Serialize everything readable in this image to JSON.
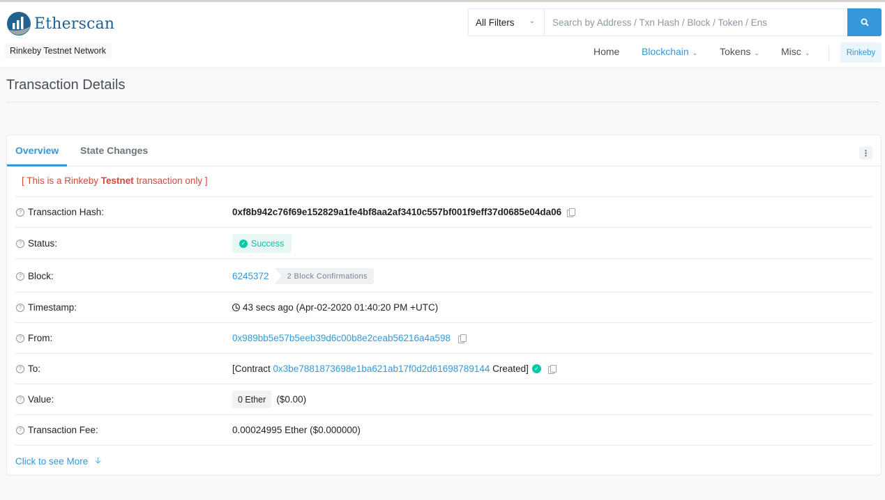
{
  "header": {
    "brand": "Etherscan",
    "network": "Rinkeby Testnet Network",
    "filter": {
      "selected": "All Filters"
    },
    "search": {
      "placeholder": "Search by Address / Txn Hash / Block / Token / Ens"
    },
    "nav": [
      {
        "label": "Home",
        "active": false
      },
      {
        "label": "Blockchain",
        "active": true,
        "dropdown": true
      },
      {
        "label": "Tokens",
        "active": false,
        "dropdown": true
      },
      {
        "label": "Misc",
        "active": false,
        "dropdown": true
      }
    ],
    "network_button": "Rinkeby"
  },
  "page": {
    "title": "Transaction Details"
  },
  "tabs": [
    {
      "label": "Overview",
      "active": true
    },
    {
      "label": "State Changes",
      "active": false
    }
  ],
  "notice": {
    "prefix": "[ This is a Rinkeby ",
    "bold": "Testnet",
    "suffix": " transaction only ]"
  },
  "details": {
    "hash": {
      "label": "Transaction Hash:",
      "value": "0xf8b942c76f69e152829a1fe4bf8aa2af3410c557bf001f9eff37d0685e04da06"
    },
    "status": {
      "label": "Status:",
      "value": "Success"
    },
    "block": {
      "label": "Block:",
      "value": "6245372",
      "confirmations": "2 Block Confirmations"
    },
    "timestamp": {
      "label": "Timestamp:",
      "value": "43 secs ago (Apr-02-2020 01:40:20 PM +UTC)"
    },
    "from": {
      "label": "From:",
      "value": "0x989bb5e57b5eeb39d6c00b8e2ceab56216a4a598"
    },
    "to": {
      "label": "To:",
      "prefix": "[Contract ",
      "address": "0x3be7881873698e1ba621ab17f0d2d61698789144",
      "suffix": " Created]"
    },
    "value": {
      "label": "Value:",
      "amount": "0 Ether",
      "usd": "($0.00)"
    },
    "fee": {
      "label": "Transaction Fee:",
      "value": "0.00024995 Ether ($0.000000)"
    }
  },
  "see_more": "Click to see More",
  "colors": {
    "accent": "#3498db",
    "success": "#00c9a7",
    "danger": "#de4437"
  }
}
